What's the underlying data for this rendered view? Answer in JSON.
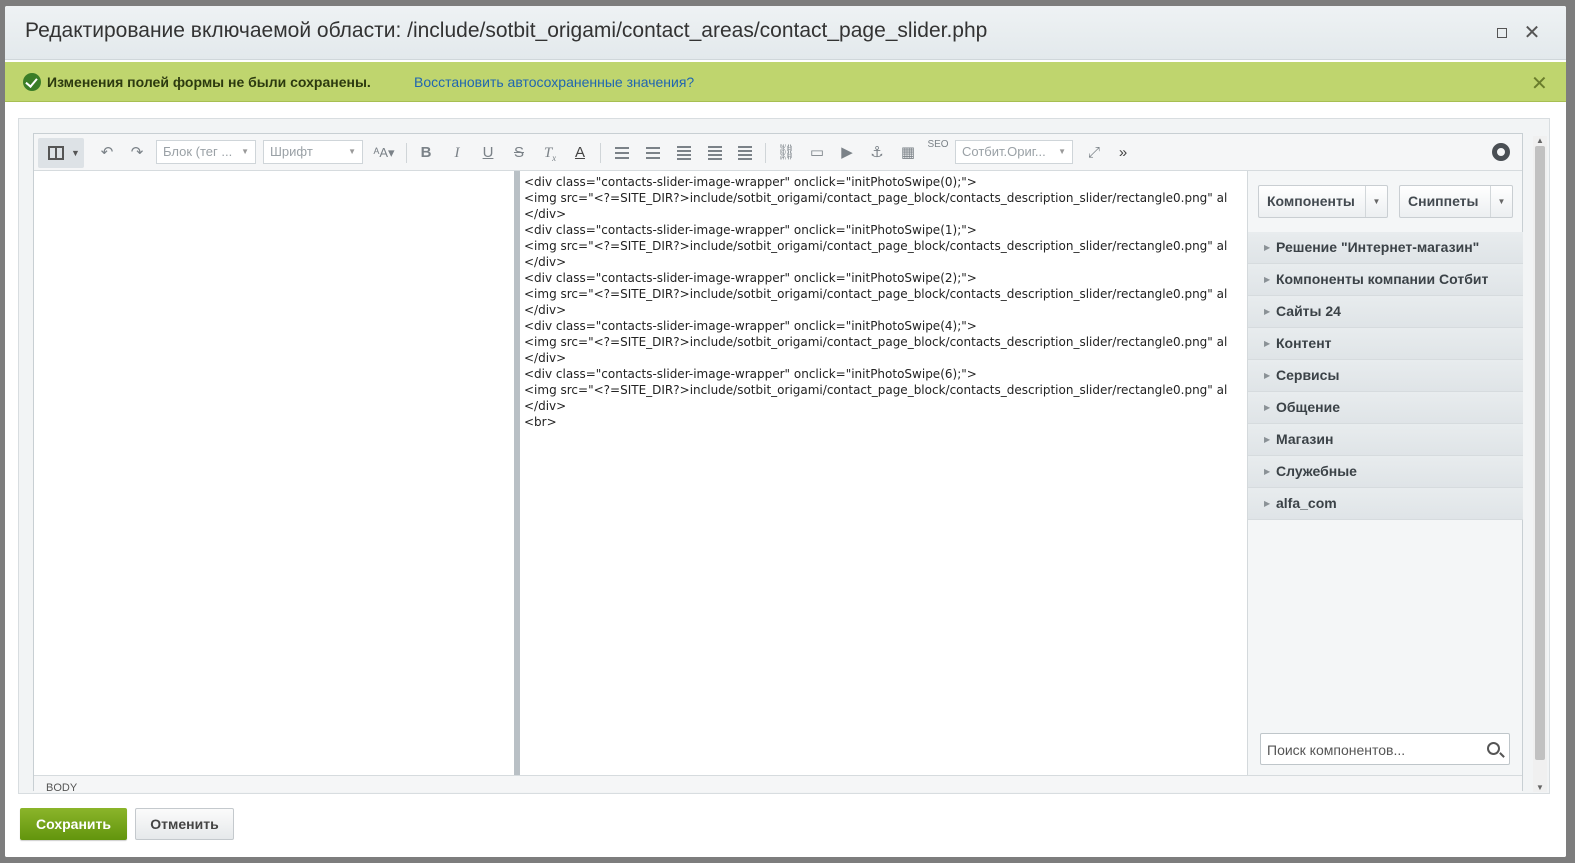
{
  "dialog": {
    "title": "Редактирование включаемой области: /include/sotbit_origami/contact_areas/contact_page_slider.php"
  },
  "notice": {
    "text": "Изменения полей формы не были сохранены.",
    "restore_link": "Восстановить автосохраненные значения?"
  },
  "toolbar": {
    "block_select": "Блок (тег ...",
    "font_select": "Шрифт",
    "seo_label": "SEO",
    "style_select": "Сотбит.Ориг...",
    "more": "»"
  },
  "code": {
    "lines": [
      "<div class=\"contacts-slider-image-wrapper\" onclick=\"initPhotoSwipe(0);\">",
      " <img src=\"<?=SITE_DIR?>include/sotbit_origami/contact_page_block/contacts_description_slider/rectangle0.png\" al",
      "</div>",
      "<div class=\"contacts-slider-image-wrapper\" onclick=\"initPhotoSwipe(1);\">",
      " <img src=\"<?=SITE_DIR?>include/sotbit_origami/contact_page_block/contacts_description_slider/rectangle0.png\" al",
      "</div>",
      "<div class=\"contacts-slider-image-wrapper\" onclick=\"initPhotoSwipe(2);\">",
      " <img src=\"<?=SITE_DIR?>include/sotbit_origami/contact_page_block/contacts_description_slider/rectangle0.png\" al",
      "</div>",
      "<div class=\"contacts-slider-image-wrapper\" onclick=\"initPhotoSwipe(4);\">",
      " <img src=\"<?=SITE_DIR?>include/sotbit_origami/contact_page_block/contacts_description_slider/rectangle0.png\" al",
      "</div>",
      "<div class=\"contacts-slider-image-wrapper\" onclick=\"initPhotoSwipe(6);\">",
      " <img src=\"<?=SITE_DIR?>include/sotbit_origami/contact_page_block/contacts_description_slider/rectangle0.png\" al",
      "</div>",
      "<br>"
    ]
  },
  "side_panel": {
    "components_button": "Компоненты",
    "snippets_button": "Сниппеты",
    "categories": [
      "Решение \"Интернет-магазин\"",
      "Компоненты компании Сотбит",
      "Сайты 24",
      "Контент",
      "Сервисы",
      "Общение",
      "Магазин",
      "Служебные",
      "alfa_com"
    ],
    "search_placeholder": "Поиск компонентов..."
  },
  "statusbar": {
    "body_tag": "BODY"
  },
  "footer": {
    "save_button": "Сохранить",
    "cancel_button": "Отменить"
  }
}
